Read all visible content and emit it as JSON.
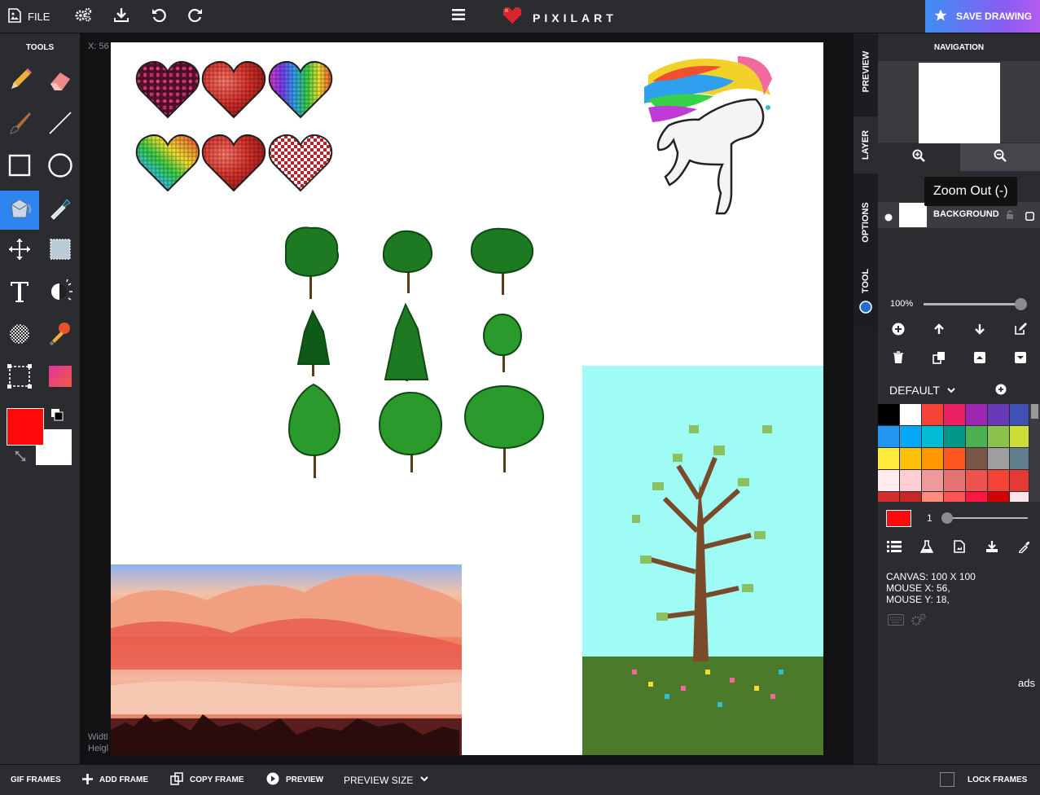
{
  "topbar": {
    "file_label": "FILE",
    "logo_text": "PIXILART",
    "save_label": "SAVE DRAWING"
  },
  "tools": {
    "title": "TOOLS",
    "items": [
      "pencil",
      "eraser",
      "brush",
      "line",
      "rectangle",
      "ellipse",
      "fill-bucket",
      "eyedropper",
      "move",
      "select-fill",
      "text",
      "dither-light",
      "dither-pattern",
      "stamp",
      "selection",
      "gradient"
    ],
    "active": "fill-bucket",
    "primary_color": "#ff0a0a",
    "secondary_color": "#ffffff"
  },
  "workspace": {
    "coord_label": "X: 56",
    "width_label": "Widtl",
    "height_label": "Heigl"
  },
  "sidetabs": [
    "PREVIEW",
    "LAYER",
    "OPTIONS",
    "TOOL"
  ],
  "navigation": {
    "title": "NAVIGATION",
    "tooltip": "Zoom Out (-)"
  },
  "layers": [
    {
      "name": "BACKGROUND"
    }
  ],
  "zoom": {
    "label": "100%",
    "level": 1.0
  },
  "palette": {
    "name": "DEFAULT",
    "colors": [
      "#000000",
      "#ffffff",
      "#f44336",
      "#e91e63",
      "#9c27b0",
      "#673ab7",
      "#3f51b5",
      "#2196f3",
      "#03a9f4",
      "#00bcd4",
      "#009688",
      "#4caf50",
      "#8bc34a",
      "#cddc39",
      "#ffeb3b",
      "#ffc107",
      "#ff9800",
      "#ff5722",
      "#795548",
      "#9e9e9e",
      "#607d8b",
      "#ffebee",
      "#ffcdd2",
      "#ef9a9a",
      "#e57373",
      "#ef5350",
      "#f44336",
      "#e53935",
      "#d32f2f",
      "#c62828",
      "#ff8a80",
      "#ff5252",
      "#ff1744",
      "#d50000",
      "#fce4ec"
    ]
  },
  "brush": {
    "current_color": "#ff0a0a",
    "size": "1"
  },
  "canvas_info": {
    "canvas": "CANVAS: 100 X 100",
    "mouse_x": "MOUSE X: 56,",
    "mouse_y": "MOUSE Y: 18,"
  },
  "ads_label": "ads",
  "bottombar": {
    "gif_frames": "GIF FRAMES",
    "add_frame": "ADD FRAME",
    "copy_frame": "COPY FRAME",
    "preview": "PREVIEW",
    "preview_size": "PREVIEW SIZE",
    "lock_frames": "LOCK FRAMES"
  }
}
